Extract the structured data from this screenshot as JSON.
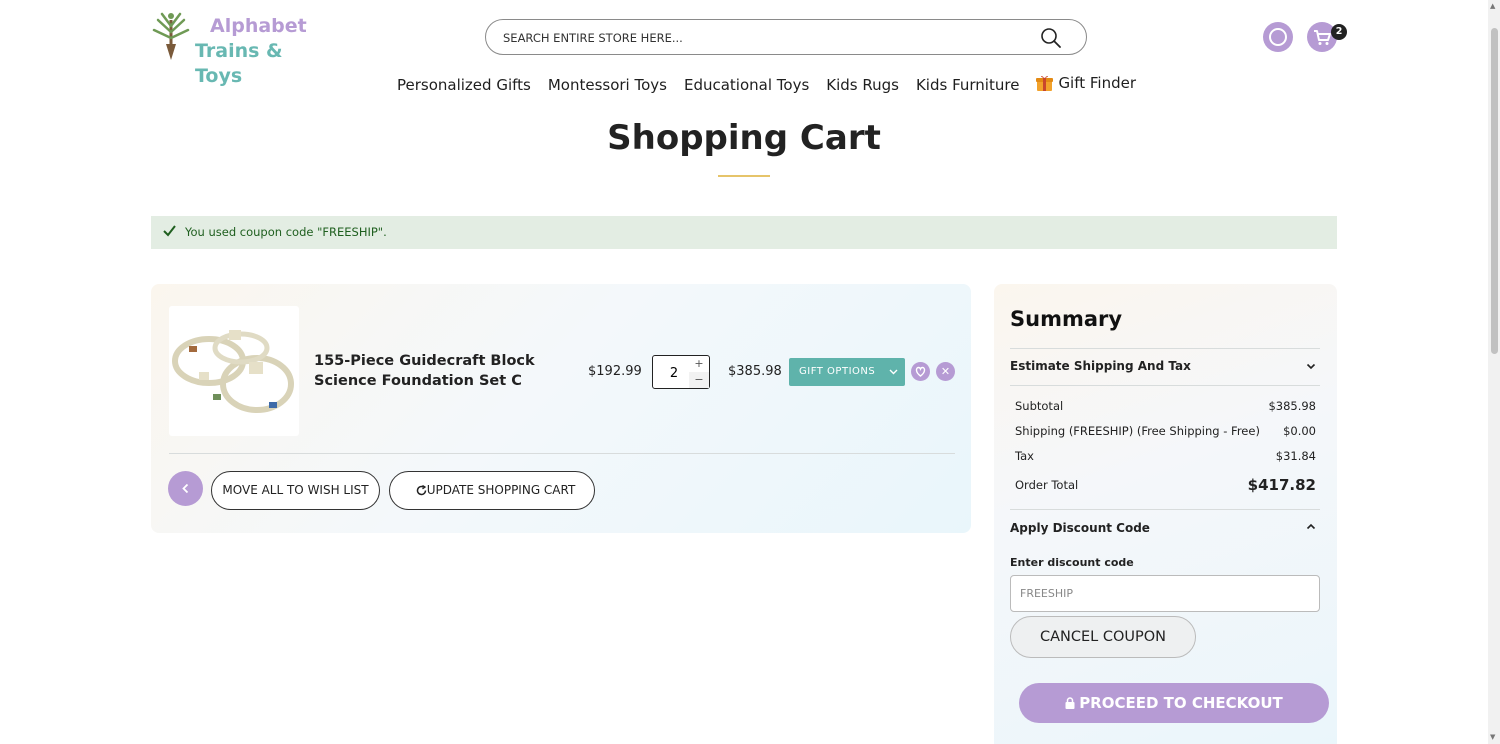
{
  "brand": {
    "line1": "Alphabet",
    "line2": "Trains & Toys",
    "colors": {
      "lavender": "#b69bd4",
      "teal": "#68b8b2",
      "gold": "#e6c46a"
    }
  },
  "search": {
    "placeholder": "SEARCH ENTIRE STORE HERE..."
  },
  "header": {
    "cart_count": "2",
    "icons": [
      "search-icon",
      "user-icon",
      "cart-icon"
    ]
  },
  "nav": {
    "items": [
      "Personalized Gifts",
      "Montessori Toys",
      "Educational Toys",
      "Kids Rugs",
      "Kids Furniture"
    ],
    "gift_finder": "Gift Finder"
  },
  "page": {
    "title": "Shopping Cart"
  },
  "message": {
    "text": "You used coupon code \"FREESHIP\"."
  },
  "cart": {
    "item": {
      "name": "155-Piece Guidecraft Block Science Foundation Set C",
      "price": "$192.99",
      "qty": "2",
      "subtotal": "$385.98",
      "gift_options": "GIFT OPTIONS"
    },
    "move_all_label": "MOVE ALL TO WISH LIST",
    "update_label": "UPDATE SHOPPING CART"
  },
  "summary": {
    "title": "Summary",
    "estimate_label": "Estimate Shipping And Tax",
    "rows": [
      {
        "label": "Subtotal",
        "value": "$385.98"
      },
      {
        "label": "Shipping (FREESHIP) (Free Shipping - Free)",
        "value": "$0.00"
      },
      {
        "label": "Tax",
        "value": "$31.84"
      }
    ],
    "order_total_label": "Order Total",
    "order_total_value": "$417.82",
    "discount_header": "Apply Discount Code",
    "discount_label": "Enter discount code",
    "discount_value": "FREESHIP",
    "cancel_label": "CANCEL COUPON",
    "checkout_label": "PROCEED TO CHECKOUT"
  }
}
